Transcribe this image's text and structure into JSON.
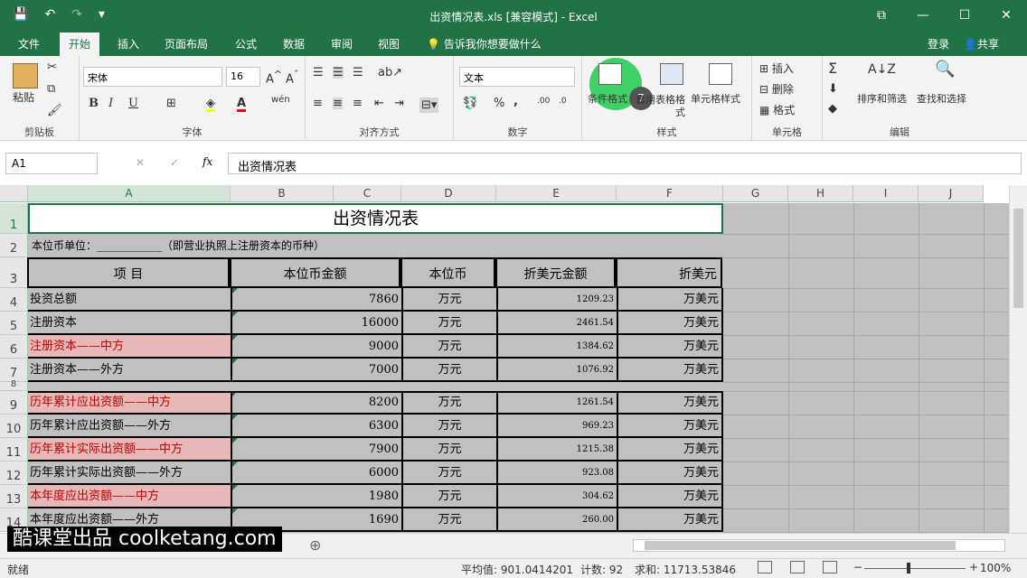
{
  "window": {
    "title": "出资情况表.xls  [兼容模式] - Excel",
    "controls": [
      "⧉",
      "—",
      "☐",
      "✕"
    ]
  },
  "qat": {
    "save": "💾",
    "undo": "↶",
    "redo": "↷",
    "more": "▾"
  },
  "menu": {
    "tabs": [
      "文件",
      "开始",
      "插入",
      "页面布局",
      "公式",
      "数据",
      "审阅",
      "视图"
    ],
    "tellme": "告诉我你想要做什么",
    "login": "登录",
    "share": "共享"
  },
  "ribbon": {
    "clipboard": {
      "paste": "粘贴",
      "label": "剪贴板"
    },
    "font": {
      "name": "宋体",
      "size": "16",
      "label": "字体",
      "bold": "B",
      "italic": "I",
      "underline": "U",
      "wen": "wén"
    },
    "align": {
      "label": "对齐方式"
    },
    "number": {
      "format": "文本",
      "label": "数字",
      "percent": "%",
      "comma": ","
    },
    "styles": {
      "cond": "条件格式",
      "table": "套用表格格式",
      "cell": "单元格样式",
      "label": "样式",
      "step": "7"
    },
    "cells": {
      "insert": "插入",
      "delete": "删除",
      "format": "格式",
      "label": "单元格"
    },
    "edit": {
      "sort": "排序和筛选",
      "find": "查找和选择",
      "label": "编辑"
    }
  },
  "formula": {
    "name": "A1",
    "content": "出资情况表",
    "fx": "fx",
    "cancel": "✕",
    "enter": "✓"
  },
  "sheet": {
    "columns": [
      "A",
      "B",
      "C",
      "D",
      "E",
      "F",
      "G",
      "H",
      "I",
      "J"
    ],
    "title": "出资情况表",
    "unit_line": "本位币单位：____________（即营业执照上注册资本的币种）",
    "headers": [
      "项    目",
      "本位币金额",
      "本位币",
      "折美元金额",
      "折美元"
    ],
    "rows": [
      {
        "row": "4",
        "item": "投资总额",
        "amount": "7860",
        "unit": "万元",
        "usd": "1209.23",
        "usdu": "万美元",
        "pink": false
      },
      {
        "row": "5",
        "item": "注册资本",
        "amount": "16000",
        "unit": "万元",
        "usd": "2461.54",
        "usdu": "万美元",
        "pink": false
      },
      {
        "row": "6",
        "item": "注册资本——中方",
        "amount": "9000",
        "unit": "万元",
        "usd": "1384.62",
        "usdu": "万美元",
        "pink": true
      },
      {
        "row": "7",
        "item": "注册资本——外方",
        "amount": "7000",
        "unit": "万元",
        "usd": "1076.92",
        "usdu": "万美元",
        "pink": false
      },
      {
        "row": "9",
        "item": "历年累计应出资额——中方",
        "amount": "8200",
        "unit": "万元",
        "usd": "1261.54",
        "usdu": "万美元",
        "pink": true
      },
      {
        "row": "10",
        "item": "历年累计应出资额——外方",
        "amount": "6300",
        "unit": "万元",
        "usd": "969.23",
        "usdu": "万美元",
        "pink": false
      },
      {
        "row": "11",
        "item": "历年累计实际出资额——中方",
        "amount": "7900",
        "unit": "万元",
        "usd": "1215.38",
        "usdu": "万美元",
        "pink": true
      },
      {
        "row": "12",
        "item": "历年累计实际出资额——外方",
        "amount": "6000",
        "unit": "万元",
        "usd": "923.08",
        "usdu": "万美元",
        "pink": false
      },
      {
        "row": "13",
        "item": "本年度应出资额——中方",
        "amount": "1980",
        "unit": "万元",
        "usd": "304.62",
        "usdu": "万美元",
        "pink": true
      },
      {
        "row": "14",
        "item": "本年度应出资额——外方",
        "amount": "1690",
        "unit": "万元",
        "usd": "260.00",
        "usdu": "万美元",
        "pink": false
      }
    ]
  },
  "tabs": {
    "add": "⊕"
  },
  "watermark": "酷课堂出品 coolketang.com",
  "status": {
    "ready": "就绪",
    "avg": "平均值: 901.0414201",
    "count": "计数: 92",
    "sum": "求和: 11713.53846",
    "zoom": "100%"
  },
  "colors": {
    "accent": "#217346",
    "pink": "#e6b8b7",
    "pinktext": "#c00000",
    "gray": "#c0c0c0"
  }
}
